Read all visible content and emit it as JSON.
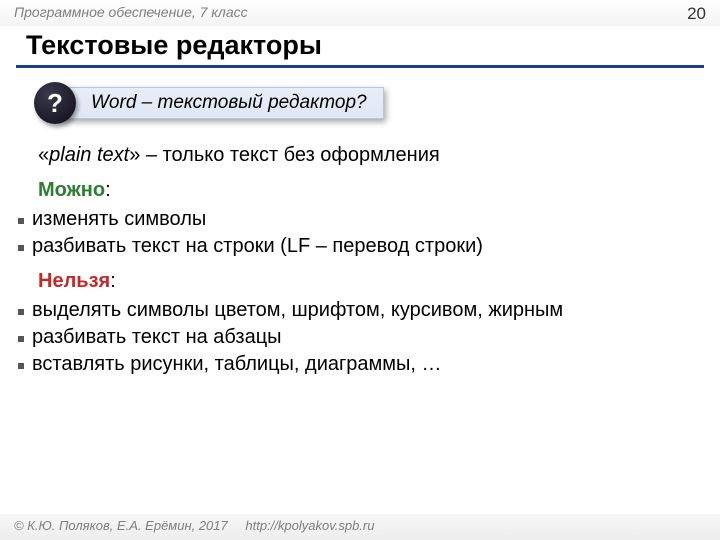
{
  "header": {
    "course": "Программное обеспечение, 7 класс",
    "page": "20"
  },
  "title": "Текстовые редакторы",
  "callout": {
    "mark": "?",
    "text": "Word – текстовый редактор?"
  },
  "plain": {
    "quote_open": "«",
    "term": "plain text",
    "quote_close": "» – только  текст без оформления"
  },
  "can_label": "Можно",
  "can_items": [
    "изменять символы",
    "разбивать текст на строки (LF – перевод строки)"
  ],
  "cant_label": "Нельзя",
  "cant_items": [
    "выделять символы цветом, шрифтом, курсивом, жирным",
    "разбивать текст на абзацы",
    "вставлять рисунки, таблицы, диаграммы, …"
  ],
  "footer": {
    "copyright": "© К.Ю. Поляков, Е.А. Ерёмин, 2017",
    "url": "http://kpolyakov.spb.ru"
  },
  "colon": ":"
}
